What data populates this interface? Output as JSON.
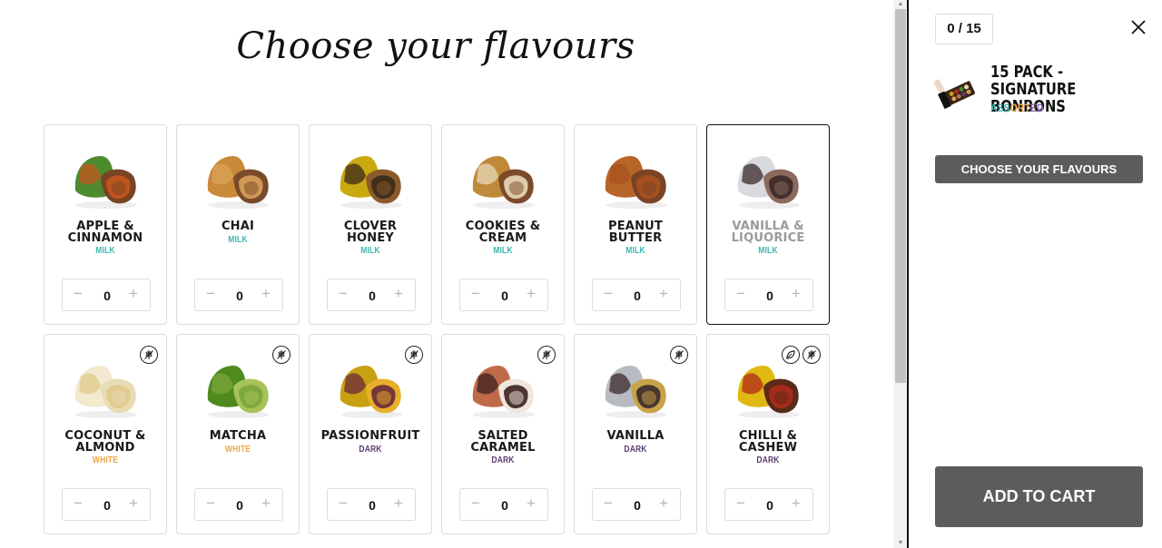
{
  "title": "Choose your flavours",
  "flavours": [
    {
      "name": "APPLE &\nCINNAMON",
      "type": "MILK",
      "qty": "0",
      "palette": [
        "#4e8a2e",
        "#c5561f",
        "#7a4424"
      ]
    },
    {
      "name": "CHAI",
      "type": "MILK",
      "qty": "0",
      "palette": [
        "#c98a3a",
        "#d9a25a",
        "#7a4a2a"
      ]
    },
    {
      "name": "CLOVER\nHONEY",
      "type": "MILK",
      "qty": "0",
      "palette": [
        "#c9a90f",
        "#3a2a1a",
        "#8a5a2a"
      ]
    },
    {
      "name": "COOKIES &\nCREAM",
      "type": "MILK",
      "qty": "0",
      "palette": [
        "#c0893a",
        "#e8d9b8",
        "#7a4a2a"
      ]
    },
    {
      "name": "PEANUT\nBUTTER",
      "type": "MILK",
      "qty": "0",
      "palette": [
        "#b8652a",
        "#a8521f",
        "#7a4424"
      ]
    },
    {
      "name": "VANILLA &\nLIQUORICE",
      "type": "MILK",
      "qty": "0",
      "palette": [
        "#d9d9e0",
        "#3a2a2a",
        "#8a6a5a"
      ]
    },
    {
      "name": "COCONUT &\nALMOND",
      "type": "WHITE",
      "qty": "0",
      "palette": [
        "#f2e9cf",
        "#e0c98a",
        "#e8dcb5"
      ]
    },
    {
      "name": "MATCHA",
      "type": "WHITE",
      "qty": "0",
      "palette": [
        "#4f8a1f",
        "#7aa63a",
        "#a8c25a"
      ]
    },
    {
      "name": "PASSIONFRUIT",
      "type": "DARK",
      "qty": "0",
      "palette": [
        "#c9a012",
        "#6a2a3a",
        "#e8b02a"
      ]
    },
    {
      "name": "SALTED\nCARAMEL",
      "type": "DARK",
      "qty": "0",
      "palette": [
        "#c06a4a",
        "#3a2220",
        "#f0e6de"
      ]
    },
    {
      "name": "VANILLA",
      "type": "DARK",
      "qty": "0",
      "palette": [
        "#b8bcc2",
        "#3a2a2a",
        "#c9a24a"
      ]
    },
    {
      "name": "CHILLI &\nCASHEW",
      "type": "DARK",
      "qty": "0",
      "palette": [
        "#e0b812",
        "#b02a1a",
        "#5a2a1a"
      ]
    }
  ],
  "stepper": {
    "minus": "−",
    "plus": "+"
  },
  "panel": {
    "counter": "0 / 15",
    "pack_title": "15 PACK - SIGNATURE BONBONS",
    "pack_sub": [
      "ASS",
      "ORT",
      "ED"
    ],
    "choose_btn": "CHOOSE YOUR FLAVOURS",
    "cart_btn": "ADD TO CART"
  },
  "colors": {
    "milk": "#3fb5b0",
    "white": "#e9a64a",
    "dark": "#5a3b6f",
    "button": "#5c5c5c"
  }
}
